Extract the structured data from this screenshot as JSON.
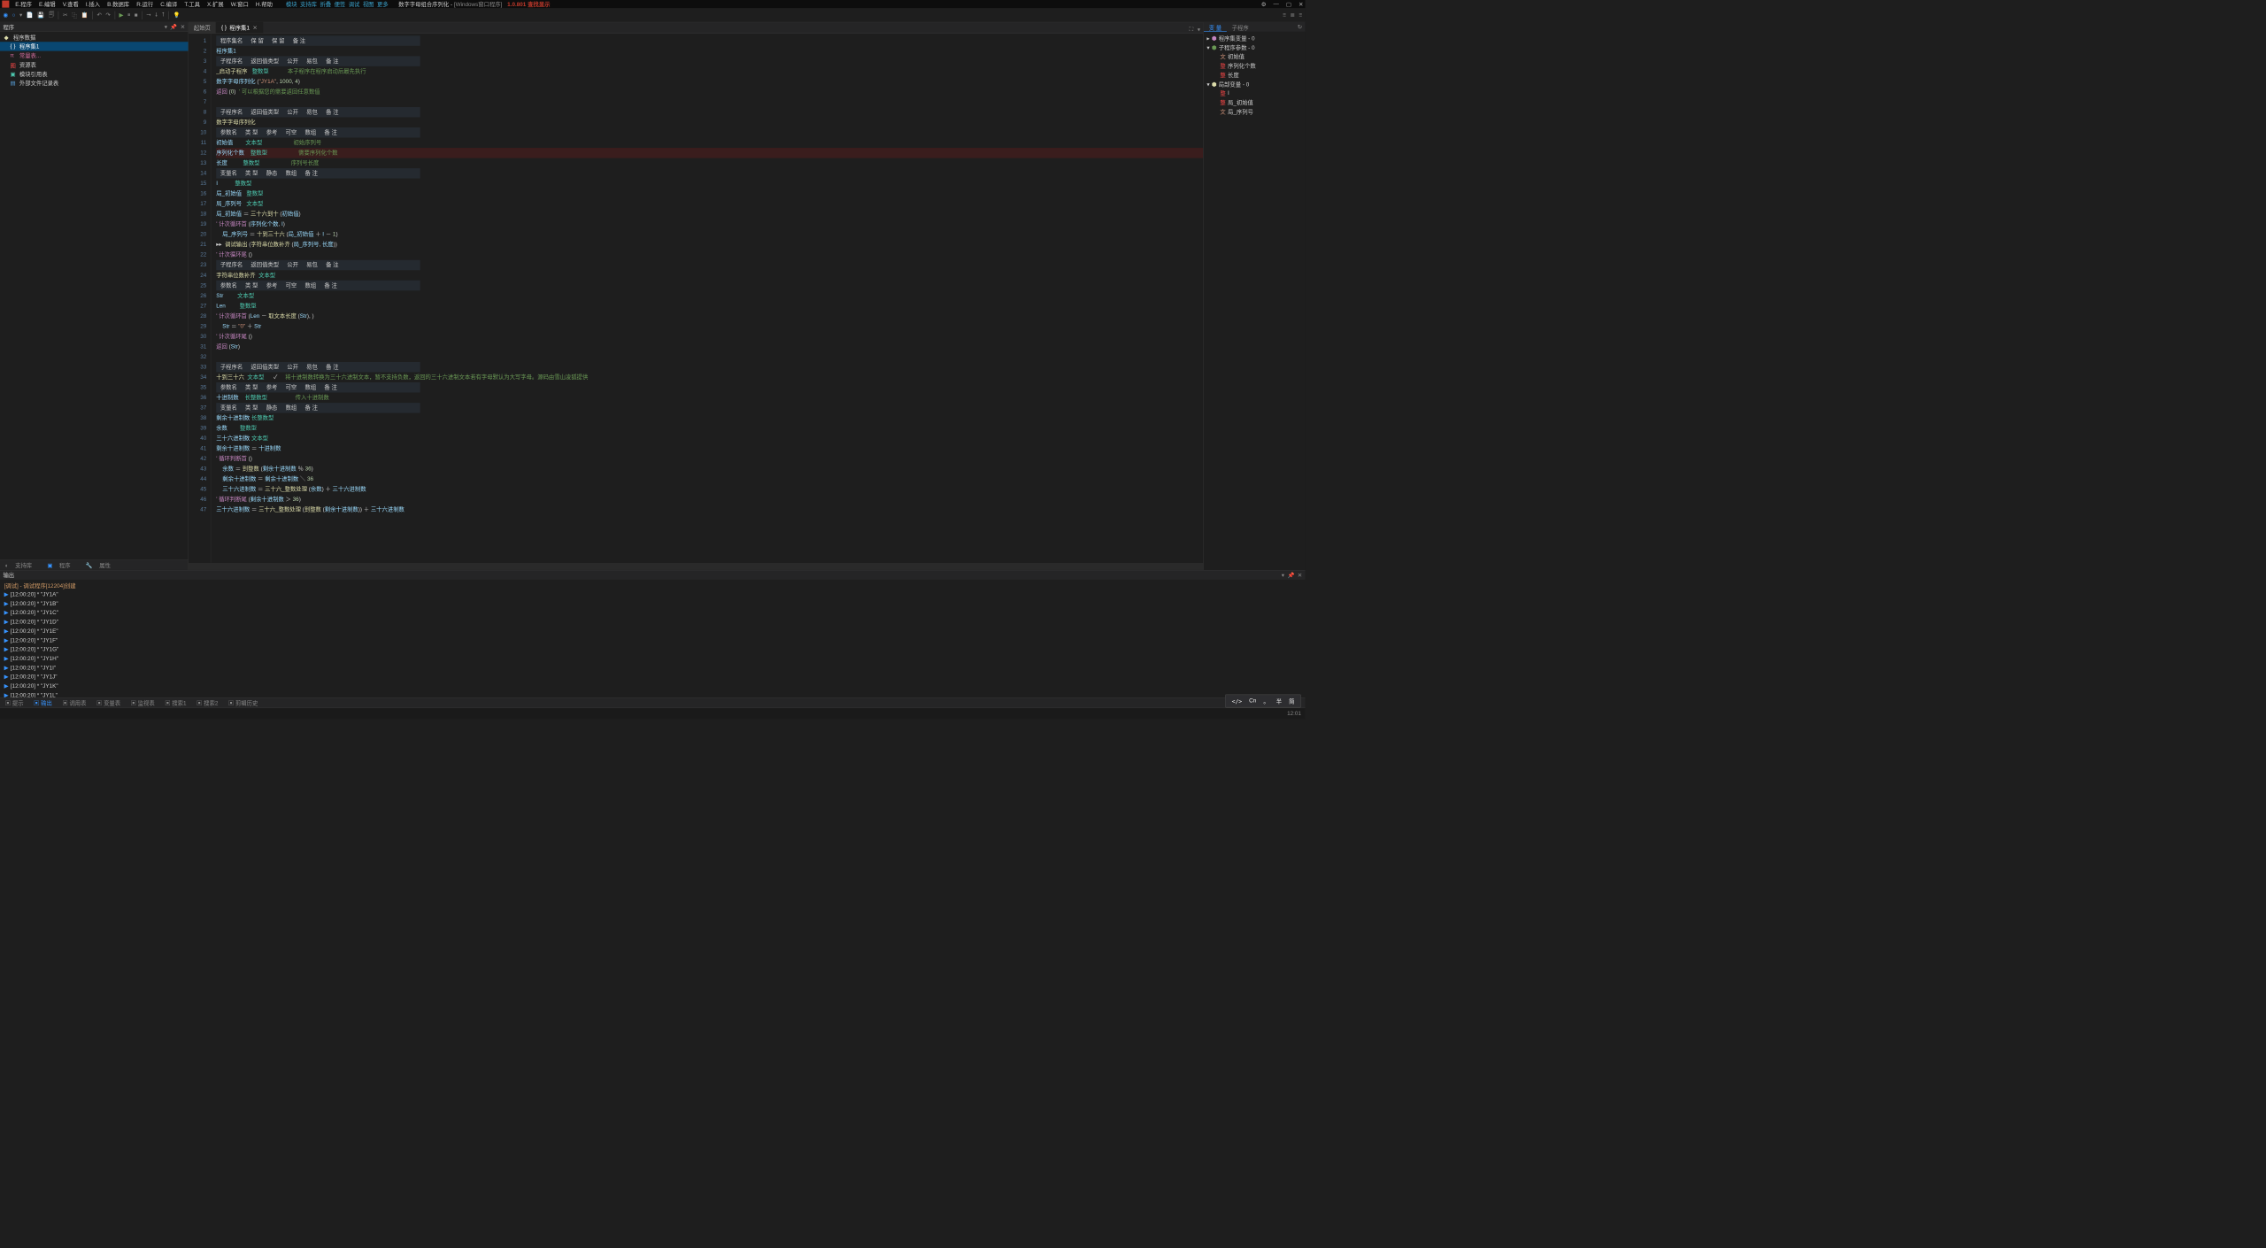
{
  "title": {
    "main": "数字字母组合序列化",
    "sub": "[Windows窗口程序]",
    "version": "1.0.801 查找显示"
  },
  "menu": [
    "E.程序",
    "E.编辑",
    "V.查看",
    "I.插入",
    "B.数据库",
    "R.运行",
    "C.编译",
    "T.工具",
    "X.扩展",
    "W.窗口",
    "H.帮助"
  ],
  "menu_extra": [
    "模块",
    "支持库",
    "折叠",
    "便签",
    "调试",
    "视图",
    "更多"
  ],
  "left": {
    "title": "程序",
    "root": "程序数据",
    "items": [
      "程序集1",
      "常量表...",
      "资源表",
      "模块引用表",
      "外部文件记录表"
    ]
  },
  "left_tabs": [
    "支持库",
    "程序",
    "属性"
  ],
  "ed_tabs": [
    {
      "label": "起始页",
      "active": false
    },
    {
      "label": "程序集1",
      "active": true
    }
  ],
  "gutter_count": 47,
  "code_lines": [
    {
      "n": 1,
      "html": "<span class='hdr'><span class='cell'>程序集名</span><span class='cell'>保 留</span><span class='cell'>保 留</span><span class='cell'>备 注</span></span>"
    },
    {
      "n": 2,
      "html": "<span class='ident'>程序集1</span>"
    },
    {
      "n": 3,
      "html": "<span class='hdr'><span class='cell'>子程序名</span><span class='cell'>返回值类型</span><span class='cell'>公开</span><span class='cell'>易包</span><span class='cell'>备 注</span></span>"
    },
    {
      "n": 4,
      "html": "<span class='fn'>_启动子程序</span>   <span class='typ'>整数型</span>            <span class='cmt'>本子程序在程序启动后最先执行</span>"
    },
    {
      "n": 5,
      "html": "<span class='ident'>数字字母序列化</span> (<span class='str'>\"JY1A\"</span>, <span class='num'>1000</span>, <span class='num'>4</span>)"
    },
    {
      "n": 6,
      "html": "<span class='redk'>返回</span> (<span class='num'>0</span>)  <span class='cmt'>' 可以根据您的需要返回任意数值</span>"
    },
    {
      "n": 7,
      "html": ""
    },
    {
      "n": 8,
      "html": "<span class='hdr'><span class='cell'>子程序名</span><span class='cell'>返回值类型</span><span class='cell'>公开</span><span class='cell'>易包</span><span class='cell'>备 注</span></span>"
    },
    {
      "n": 9,
      "html": "<span class='fn'>数字字母序列化</span>"
    },
    {
      "n": 10,
      "html": "<span class='hdr'><span class='cell'>参数名</span><span class='cell'>类 型</span><span class='cell'>参考</span><span class='cell'>可空</span><span class='cell'>数组</span><span class='cell'>备 注</span></span>"
    },
    {
      "n": 11,
      "html": "<span class='ident'>初始值</span>        <span class='typ'>文本型</span>                    <span class='cmt'>初始序列号</span>"
    },
    {
      "n": 12,
      "html": "<span class='ident'>序列化个数</span>    <span class='typ'>整数型</span>                    <span class='cmt'>需要序列化个数</span>",
      "bp": true
    },
    {
      "n": 13,
      "html": "<span class='ident'>长度</span>          <span class='typ'>整数型</span>                    <span class='cmt'>序列号长度</span>"
    },
    {
      "n": 14,
      "html": "<span class='hdr'><span class='cell'>变量名</span><span class='cell'>类 型</span><span class='cell'>静态</span><span class='cell'>数组</span><span class='cell'>备 注</span></span>"
    },
    {
      "n": 15,
      "html": "<span class='ident'>I</span>           <span class='typ'>整数型</span>"
    },
    {
      "n": 16,
      "html": "<span class='ident'>局_初始值</span>   <span class='typ'>整数型</span>"
    },
    {
      "n": 17,
      "html": "<span class='ident'>局_序列号</span>   <span class='typ'>文本型</span>"
    },
    {
      "n": 18,
      "html": "<span class='ident'>局_初始值</span> ＝ <span class='fn'>三十六到十</span> (<span class='ident'>初始值</span>)"
    },
    {
      "n": 19,
      "html": "<span class='redk'>' 计次循环首</span> (<span class='ident'>序列化个数</span>, <span class='ident'>I</span>)"
    },
    {
      "n": 20,
      "html": "    <span class='ident'>局_序列号</span> ＝ <span class='fn'>十到三十六</span> (<span class='ident'>局_初始值</span> ＋ <span class='ident'>I</span> － <span class='num'>1</span>)"
    },
    {
      "n": 21,
      "html": "<span class='op'>▸▸</span>  <span class='fn'>调试输出</span> (<span class='fn'>字符串位数补齐</span> (<span class='ident'>局_序列号</span>, <span class='ident'>长度</span>))"
    },
    {
      "n": 22,
      "html": "<span class='redk'>' 计次循环尾</span> ()"
    },
    {
      "n": 23,
      "html": "<span class='hdr'><span class='cell'>子程序名</span><span class='cell'>返回值类型</span><span class='cell'>公开</span><span class='cell'>易包</span><span class='cell'>备 注</span></span>"
    },
    {
      "n": 24,
      "html": "<span class='fn'>字符串位数补齐</span>  <span class='typ'>文本型</span>"
    },
    {
      "n": 25,
      "html": "<span class='hdr'><span class='cell'>参数名</span><span class='cell'>类 型</span><span class='cell'>参考</span><span class='cell'>可空</span><span class='cell'>数组</span><span class='cell'>备 注</span></span>"
    },
    {
      "n": 26,
      "html": "<span class='ident'>Str</span>         <span class='typ'>文本型</span>"
    },
    {
      "n": 27,
      "html": "<span class='ident'>Len</span>         <span class='typ'>整数型</span>"
    },
    {
      "n": 28,
      "html": "<span class='redk'>' 计次循环首</span> (<span class='ident'>Len</span> － <span class='fn'>取文本长度</span> (<span class='ident'>Str</span>), )"
    },
    {
      "n": 29,
      "html": "    <span class='ident'>Str</span> ＝ <span class='str'>\"0\"</span> ＋ <span class='ident'>Str</span>"
    },
    {
      "n": 30,
      "html": "<span class='redk'>' 计次循环尾</span> ()"
    },
    {
      "n": 31,
      "html": "<span class='redk'>返回</span> (<span class='ident'>Str</span>)"
    },
    {
      "n": 32,
      "html": ""
    },
    {
      "n": 33,
      "html": "<span class='hdr'><span class='cell'>子程序名</span><span class='cell'>返回值类型</span><span class='cell'>公开</span><span class='cell'>易包</span><span class='cell'>备 注</span></span>"
    },
    {
      "n": 34,
      "html": "<span class='fn'>十到三十六</span>  <span class='typ'>文本型</span>      ✓     <span class='cmt'>将十进制数转换为三十六进制文本，暂不支持负数，返回的三十六进制文本若有字母默认为大写字母。源码由雪山凌狐提供</span>"
    },
    {
      "n": 35,
      "html": "<span class='hdr'><span class='cell'>参数名</span><span class='cell'>类 型</span><span class='cell'>参考</span><span class='cell'>可空</span><span class='cell'>数组</span><span class='cell'>备 注</span></span>"
    },
    {
      "n": 36,
      "html": "<span class='ident'>十进制数</span>    <span class='typ'>长整数型</span>                  <span class='cmt'>传入十进制数</span>"
    },
    {
      "n": 37,
      "html": "<span class='hdr'><span class='cell'>变量名</span><span class='cell'>类 型</span><span class='cell'>静态</span><span class='cell'>数组</span><span class='cell'>备 注</span></span>"
    },
    {
      "n": 38,
      "html": "<span class='ident'>剩余十进制数</span> <span class='typ'>长整数型</span>"
    },
    {
      "n": 39,
      "html": "<span class='ident'>余数</span>        <span class='typ'>整数型</span>"
    },
    {
      "n": 40,
      "html": "<span class='ident'>三十六进制数</span> <span class='typ'>文本型</span>"
    },
    {
      "n": 41,
      "html": "<span class='ident'>剩余十进制数</span> ＝ <span class='ident'>十进制数</span>"
    },
    {
      "n": 42,
      "html": "<span class='redk'>' 循环判断首</span> ()"
    },
    {
      "n": 43,
      "html": "    <span class='ident'>余数</span> ＝ <span class='fn'>到整数</span> (<span class='ident'>剩余十进制数</span> ％ <span class='num'>36</span>)"
    },
    {
      "n": 44,
      "html": "    <span class='ident'>剩余十进制数</span> ＝ <span class='ident'>剩余十进制数</span> ＼ <span class='num'>36</span>"
    },
    {
      "n": 45,
      "html": "    <span class='ident'>三十六进制数</span> ＝ <span class='fn'>三十六_整数处理</span> (<span class='ident'>余数</span>) ＋ <span class='ident'>三十六进制数</span>"
    },
    {
      "n": 46,
      "html": "<span class='redk'>' 循环判断尾</span> (<span class='ident'>剩余十进制数</span> ＞ <span class='num'>36</span>)"
    },
    {
      "n": 47,
      "html": "<span class='ident'>三十六进制数</span> ＝ <span class='fn'>三十六_整数处理</span> (<span class='fn'>到整数</span> (<span class='ident'>剩余十进制数</span>)) ＋ <span class='ident'>三十六进制数</span>"
    }
  ],
  "right": {
    "tabs": [
      "变 量",
      "子程序"
    ],
    "groups": [
      {
        "label": "程序集变量 - 0",
        "icon": "purple"
      },
      {
        "label": "子程序参数 - 0",
        "icon": "green",
        "open": true,
        "children": [
          {
            "label": "初始值",
            "icon": "文",
            "c": "c-orange"
          },
          {
            "label": "序列化个数",
            "icon": "整",
            "c": "c-red"
          },
          {
            "label": "长度",
            "icon": "整",
            "c": "c-red"
          }
        ]
      },
      {
        "label": "局部变量 - 0",
        "icon": "yellow",
        "open": true,
        "children": [
          {
            "label": "I",
            "icon": "整",
            "c": "c-red"
          },
          {
            "label": "局_初始值",
            "icon": "整",
            "c": "c-red"
          },
          {
            "label": "局_序列号",
            "icon": "文",
            "c": "c-orange"
          }
        ]
      }
    ]
  },
  "output": {
    "title": "输出",
    "first": "[调试] - 调试程序[12204]创建",
    "lines": [
      "[12:00:20]  *  \"JY1A\"",
      "[12:00:20]  *  \"JY1B\"",
      "[12:00:20]  *  \"JY1C\"",
      "[12:00:20]  *  \"JY1D\"",
      "[12:00:20]  *  \"JY1E\"",
      "[12:00:20]  *  \"JY1F\"",
      "[12:00:20]  *  \"JY1G\"",
      "[12:00:20]  *  \"JY1H\"",
      "[12:00:20]  *  \"JY1I\"",
      "[12:00:20]  *  \"JY1J\"",
      "[12:00:20]  *  \"JY1K\"",
      "[12:00:20]  *  \"JY1L\""
    ]
  },
  "out_tabs": [
    "提示",
    "输出",
    "调用表",
    "变量表",
    "监视表",
    "搜索1",
    "搜索2",
    "剪辑历史"
  ],
  "status": {
    "right": "12:01"
  },
  "ime": {
    "lang": "Cn",
    "punct": "。",
    "width": "半",
    "mode": "简"
  }
}
